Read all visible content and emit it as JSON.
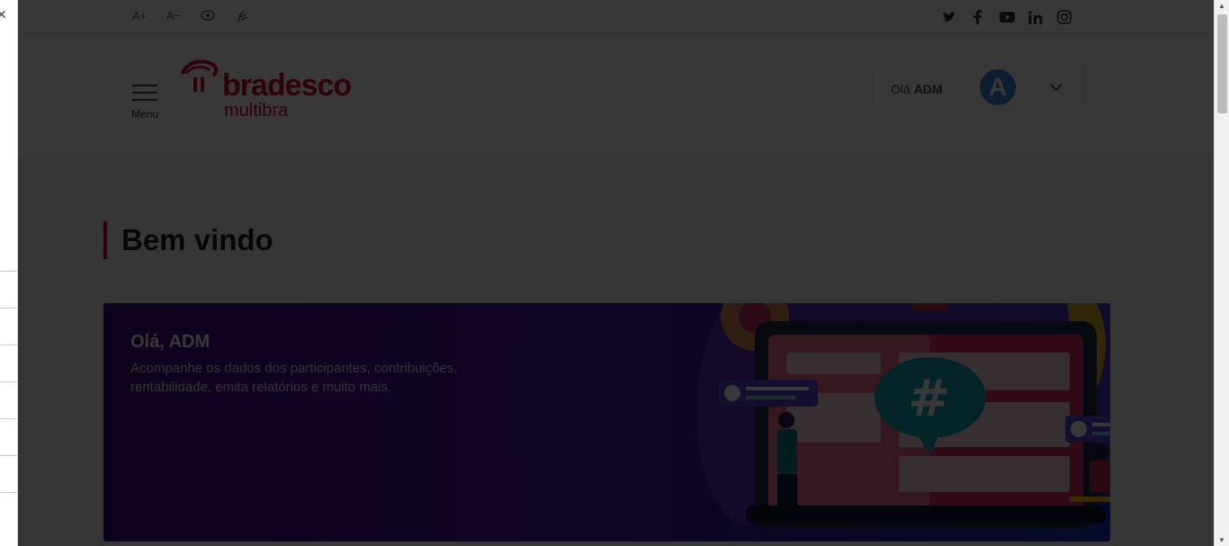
{
  "accessibility": {
    "increase_font": "A+",
    "decrease_font": "A−"
  },
  "social": {
    "twitter": "twitter-icon",
    "facebook": "facebook-icon",
    "youtube": "youtube-icon",
    "linkedin": "linkedin-icon",
    "instagram": "instagram-icon"
  },
  "header": {
    "menu_label": "Menu",
    "logo_word": "bradesco",
    "logo_sub": "multibra",
    "greeting_prefix": "Olá",
    "greeting_name": "ADM",
    "avatar_letter": "A"
  },
  "main": {
    "title": "Bem vindo",
    "banner_title": "Olá, ADM",
    "banner_text": "Acompanhe os dados dos participantes, contribuições, rentabilidade, emita relatórios e muito mais."
  },
  "colors": {
    "brand": "#cc092f",
    "banner_start": "#3e0a82",
    "banner_end": "#1a2fbf",
    "avatar": "#3a87d6"
  }
}
